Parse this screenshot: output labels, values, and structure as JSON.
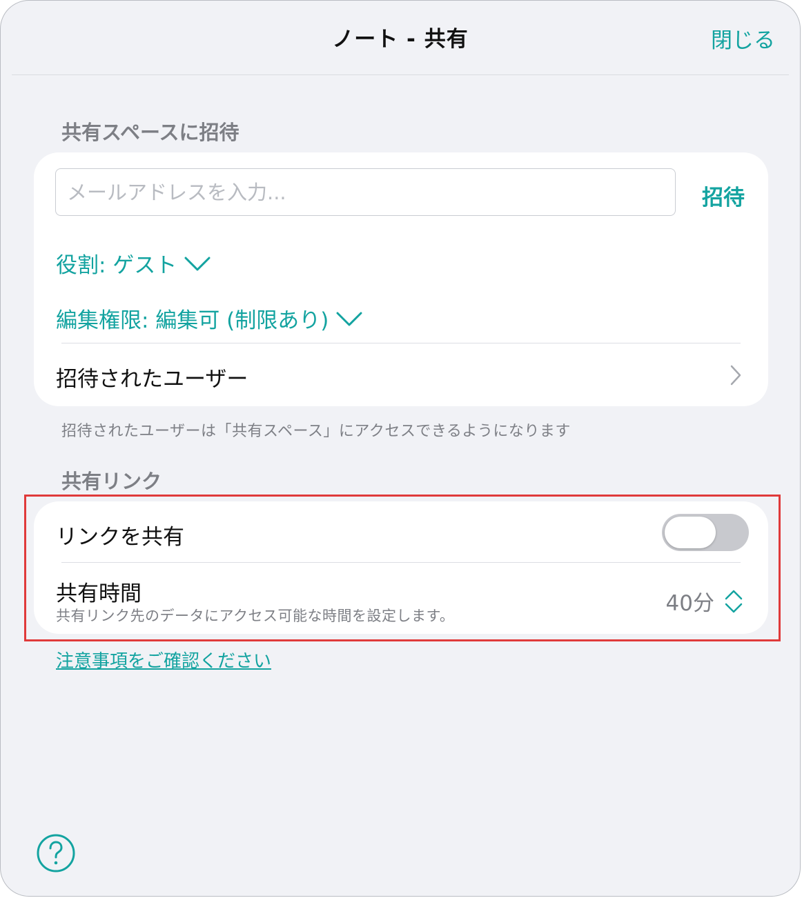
{
  "header": {
    "title": "ノート - 共有",
    "close_label": "閉じる"
  },
  "invite_section": {
    "title": "共有スペースに招待",
    "email_placeholder": "メールアドレスを入力...",
    "invite_button": "招待",
    "role_label": "役割: ゲスト",
    "permission_label": "編集権限: 編集可 (制限あり)",
    "invited_users_label": "招待されたユーザー",
    "note": "招待されたユーザーは「共有スペース」にアクセスできるようになります"
  },
  "share_link_section": {
    "title": "共有リンク",
    "share_link_label": "リンクを共有",
    "share_link_enabled": false,
    "duration_label": "共有時間",
    "duration_description": "共有リンク先のデータにアクセス可能な時間を設定します。",
    "duration_value": "40分"
  },
  "notice_link": "注意事項をご確認ください",
  "icons": {
    "chevron_down": "chevron-down-icon",
    "chevron_right": "chevron-right-icon",
    "stepper": "up-down-chevron-icon",
    "help": "help-circle-icon"
  },
  "colors": {
    "accent": "#13a3a0",
    "highlight": "#e03a3a",
    "toggle_off": "#c8c9ce"
  }
}
